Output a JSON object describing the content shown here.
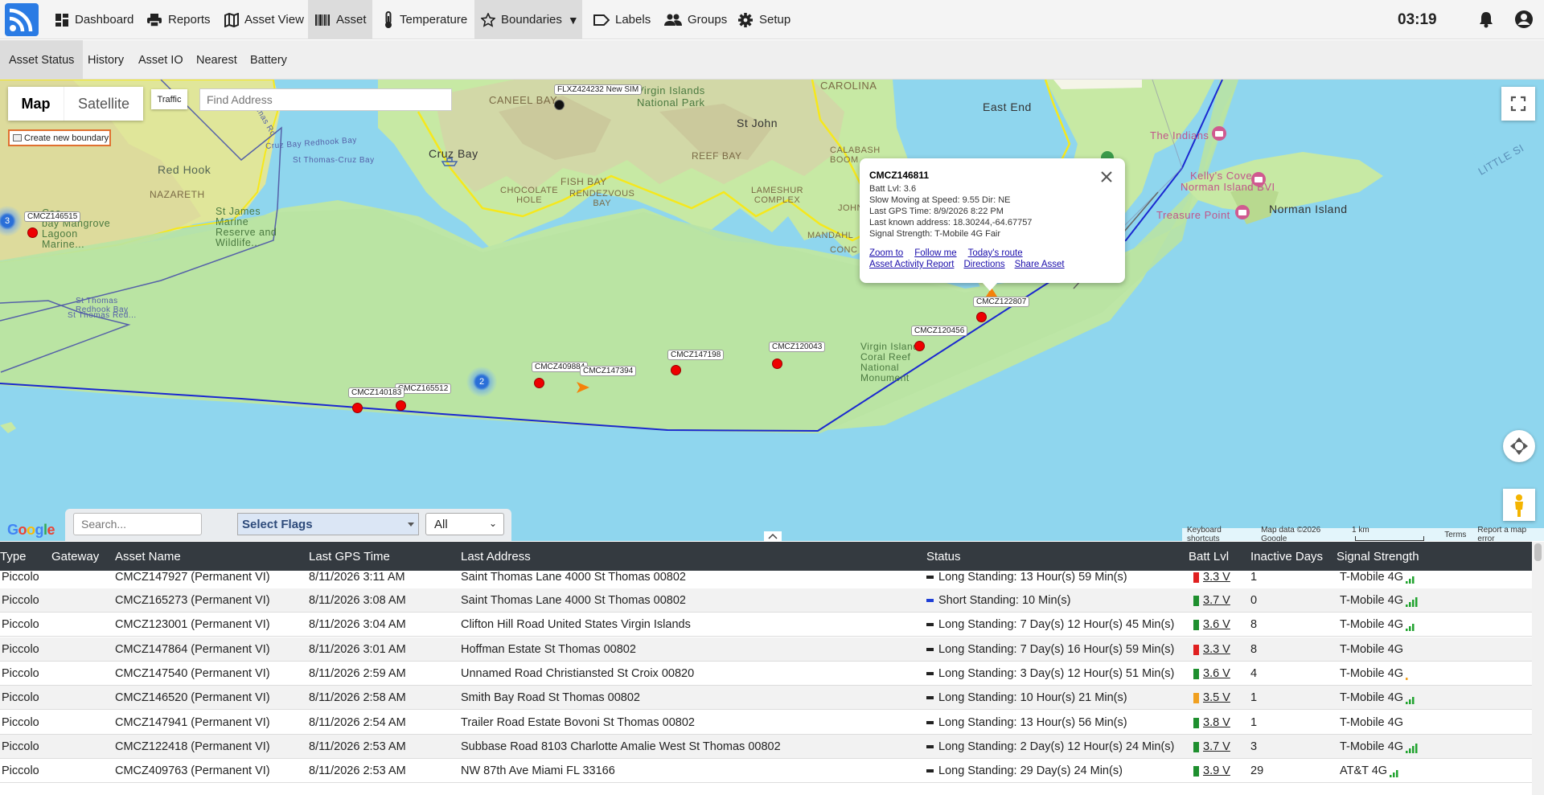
{
  "nav": {
    "items": [
      {
        "label": "Dashboard"
      },
      {
        "label": "Reports"
      },
      {
        "label": "Asset View"
      },
      {
        "label": "Asset"
      },
      {
        "label": "Temperature"
      },
      {
        "label": "Boundaries"
      },
      {
        "label": "Labels"
      },
      {
        "label": "Groups"
      },
      {
        "label": "Setup"
      }
    ],
    "clock": "03:19"
  },
  "subnav": {
    "items": [
      {
        "label": "Asset Status"
      },
      {
        "label": "History"
      },
      {
        "label": "Asset IO"
      },
      {
        "label": "Nearest"
      },
      {
        "label": "Battery"
      }
    ]
  },
  "map": {
    "type_map": "Map",
    "type_satellite": "Satellite",
    "traffic": "Traffic",
    "find_placeholder": "Find Address",
    "new_boundary": "Create new boundary",
    "place_labels": {
      "caneel": "CANEEL BAY",
      "virgin_np": "Virgin Islands\nNational Park",
      "carolina": "CAROLINA",
      "east_end": "East End",
      "indians": "The Indians",
      "kellys": "Kelly's Cove",
      "norman_bvi": "Norman Island BVI",
      "treasure": "Treasure Point",
      "norman": "Norman Island",
      "little": "LITTLE SI",
      "st_john": "St John",
      "reef_bay": "REEF BAY",
      "cruz_bay": "Cruz Bay",
      "fish_bay": "FISH BAY",
      "chocolate": "CHOCOLATE\nHOLE",
      "rendezvous": "RENDEZVOUS\nBAY",
      "lameshur": "LAMESHUR\nCOMPLEX",
      "calabash": "CALABASH\nBOOM",
      "mandahl": "MANDAHL",
      "conc": "CONC",
      "john": "JOHN",
      "red_hook": "Red Hook",
      "nazareth": "NAZARETH",
      "lagoon": "Cas\nbay Mangrove\nLagoon\nMarine...",
      "st_james": "St James\nMarine\nReserve and\nWildlife...",
      "cruz_bay_redhook": "Cruz Bay Redhook Bay",
      "st_thomas_cruz": "St Thomas-Cruz Bay",
      "st_thomas_red": "St Thomas\nRedhook Bay",
      "thomas_rd": "Thomas Rd",
      "st_thomas_red2": "St Thomas Red...",
      "coral_reef": "Virgin Islands\nCoral Reef\nNational\nMonument"
    },
    "assets": [
      {
        "label": "FLXZ424232 New SIM"
      },
      {
        "label": "CMCZ146515"
      },
      {
        "label": "CMCZ122807"
      },
      {
        "label": "CMCZ120456"
      },
      {
        "label": "CMCZ120043"
      },
      {
        "label": "CMCZ147198"
      },
      {
        "label": "CMCZ409884"
      },
      {
        "label": "CMCZ147394"
      },
      {
        "label": "CMCZ165512"
      },
      {
        "label": "CMCZ140183"
      }
    ],
    "clusters": [
      {
        "count": "3"
      },
      {
        "count": "2"
      }
    ],
    "popup": {
      "title": "CMCZ146811",
      "lines": [
        "Batt Lvl: 3.6",
        "Slow Moving at Speed: 9.55 Dir: NE",
        "Last GPS Time: 8/9/2026 8:22 PM",
        "Last known address: 18.30244,-64.67757",
        "Signal Strength: T-Mobile 4G Fair"
      ],
      "links": [
        "Zoom to",
        "Follow me",
        "Today's route",
        "Asset Activity Report",
        "Directions",
        "Share Asset"
      ]
    },
    "search_placeholder": "Search...",
    "flags_select": "Select Flags",
    "all_select": "All",
    "google": "Google",
    "attribution": {
      "shortcuts": "Keyboard shortcuts",
      "mapdata": "Map data ©2026 Google",
      "scale": "1 km",
      "terms": "Terms",
      "report": "Report a map error"
    }
  },
  "table": {
    "columns": [
      "Type",
      "Gateway",
      "Asset Name",
      "Last GPS Time",
      "Last Address",
      "Status",
      "Batt Lvl",
      "Inactive Days",
      "Signal Strength"
    ],
    "rows": [
      {
        "type": "Piccolo",
        "name": "CMCZ147927 (Permanent VI)",
        "gps": "8/11/2026 3:11 AM",
        "address": "Saint Thomas Lane 4000 St Thomas 00802",
        "status": "Long Standing: 13 Hour(s) 59 Min(s)",
        "status_color": "#222222",
        "batt": "3.3 V",
        "batt_color": "#e02020",
        "inactive": "1",
        "signal": "T-Mobile 4G",
        "signal_bars": 3,
        "signal_color": "#21a32f"
      },
      {
        "type": "Piccolo",
        "name": "CMCZ165273 (Permanent VI)",
        "gps": "8/11/2026 3:08 AM",
        "address": "Saint Thomas Lane 4000 St Thomas 00802",
        "status": "Short Standing: 10 Min(s)",
        "status_color": "#1f3fd6",
        "batt": "3.7 V",
        "batt_color": "#1e8f2e",
        "inactive": "0",
        "signal": "T-Mobile 4G",
        "signal_bars": 4,
        "signal_color": "#21a32f"
      },
      {
        "type": "Piccolo",
        "name": "CMCZ123001 (Permanent VI)",
        "gps": "8/11/2026 3:04 AM",
        "address": "Clifton Hill Road United States Virgin Islands",
        "status": "Long Standing: 7 Day(s) 12 Hour(s) 45 Min(s)",
        "status_color": "#222222",
        "batt": "3.6 V",
        "batt_color": "#1e8f2e",
        "inactive": "8",
        "signal": "T-Mobile 4G",
        "signal_bars": 3,
        "signal_color": "#21a32f"
      },
      {
        "type": "Piccolo",
        "name": "CMCZ147864 (Permanent VI)",
        "gps": "8/11/2026 3:01 AM",
        "address": "Hoffman Estate St Thomas 00802",
        "status": "Long Standing: 7 Day(s) 16 Hour(s) 59 Min(s)",
        "status_color": "#222222",
        "batt": "3.3 V",
        "batt_color": "#e02020",
        "inactive": "8",
        "signal": "T-Mobile 4G",
        "signal_bars": 0,
        "signal_color": "#21a32f"
      },
      {
        "type": "Piccolo",
        "name": "CMCZ147540 (Permanent VI)",
        "gps": "8/11/2026 2:59 AM",
        "address": "Unnamed Road Christiansted St Croix 00820",
        "status": "Long Standing: 3 Day(s) 12 Hour(s) 51 Min(s)",
        "status_color": "#222222",
        "batt": "3.6 V",
        "batt_color": "#1e8f2e",
        "inactive": "4",
        "signal": "T-Mobile 4G",
        "signal_bars": 1,
        "signal_color": "#f0a020"
      },
      {
        "type": "Piccolo",
        "name": "CMCZ146520 (Permanent VI)",
        "gps": "8/11/2026 2:58 AM",
        "address": "Smith Bay Road St Thomas 00802",
        "status": "Long Standing: 10 Hour(s) 21 Min(s)",
        "status_color": "#222222",
        "batt": "3.5 V",
        "batt_color": "#f0a020",
        "inactive": "1",
        "signal": "T-Mobile 4G",
        "signal_bars": 3,
        "signal_color": "#21a32f"
      },
      {
        "type": "Piccolo",
        "name": "CMCZ147941 (Permanent VI)",
        "gps": "8/11/2026 2:54 AM",
        "address": "Trailer Road Estate Bovoni St Thomas 00802",
        "status": "Long Standing: 13 Hour(s) 56 Min(s)",
        "status_color": "#222222",
        "batt": "3.8 V",
        "batt_color": "#1e8f2e",
        "inactive": "1",
        "signal": "T-Mobile 4G",
        "signal_bars": 0,
        "signal_color": "#21a32f"
      },
      {
        "type": "Piccolo",
        "name": "CMCZ122418 (Permanent VI)",
        "gps": "8/11/2026 2:53 AM",
        "address": "Subbase Road 8103 Charlotte Amalie West St Thomas 00802",
        "status": "Long Standing: 2 Day(s) 12 Hour(s) 24 Min(s)",
        "status_color": "#222222",
        "batt": "3.7 V",
        "batt_color": "#1e8f2e",
        "inactive": "3",
        "signal": "T-Mobile 4G",
        "signal_bars": 4,
        "signal_color": "#21a32f"
      },
      {
        "type": "Piccolo",
        "name": "CMCZ409763 (Permanent VI)",
        "gps": "8/11/2026 2:53 AM",
        "address": "NW 87th Ave Miami FL 33166",
        "status": "Long Standing: 29 Day(s) 24 Min(s)",
        "status_color": "#222222",
        "batt": "3.9 V",
        "batt_color": "#1e8f2e",
        "inactive": "29",
        "signal": "AT&T 4G",
        "signal_bars": 3,
        "signal_color": "#21a32f"
      }
    ]
  }
}
